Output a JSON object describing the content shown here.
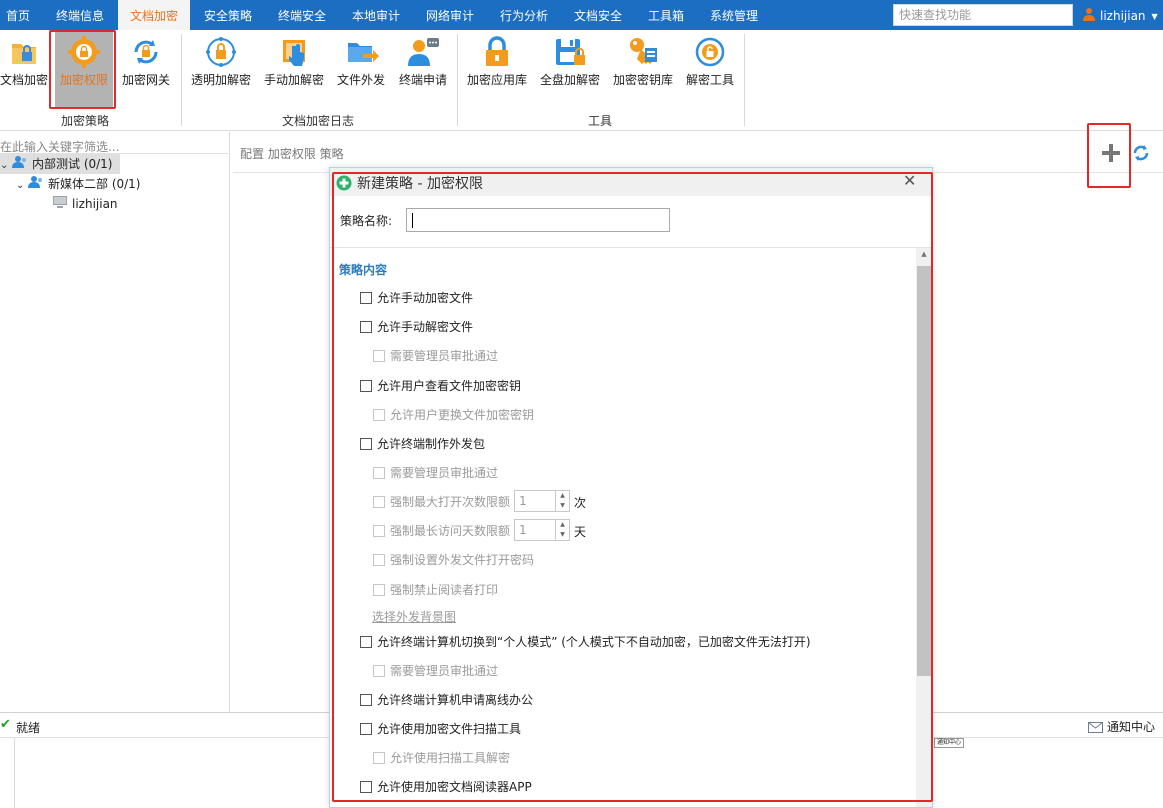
{
  "menu": {
    "items": [
      "首页",
      "终端信息",
      "文档加密",
      "安全策略",
      "终端安全",
      "本地审计",
      "网络审计",
      "行为分析",
      "文档安全",
      "工具箱",
      "系统管理"
    ],
    "active_index": 2,
    "search_placeholder": "快速查找功能",
    "username": "lizhijian"
  },
  "ribbon": {
    "groups": [
      {
        "label": "加密策略",
        "buttons": [
          "文档加密",
          "加密权限",
          "加密网关"
        ]
      },
      {
        "label": "文档加密日志",
        "buttons": [
          "透明加解密",
          "手动加解密",
          "文件外发",
          "终端申请"
        ]
      },
      {
        "label": "工具",
        "buttons": [
          "加密应用库",
          "全盘加解密",
          "加密密钥库",
          "解密工具"
        ]
      }
    ],
    "selected_button": "加密权限"
  },
  "left_panel": {
    "filter_placeholder": "在此输入关键字筛选...",
    "tree": [
      {
        "label": "内部测试 (0/1)",
        "level": 0,
        "expanded": true,
        "icon": "users-icon",
        "selected": true
      },
      {
        "label": "新媒体二部 (0/1)",
        "level": 1,
        "expanded": true,
        "icon": "users-icon"
      },
      {
        "label": "lizhijian",
        "level": 2,
        "icon": "computer-icon"
      }
    ]
  },
  "breadcrumb": "配置 加密权限 策略",
  "status": {
    "text": "就绪",
    "notify": "通知中心",
    "mini_tab": "通知中心"
  },
  "dialog": {
    "title": "新建策略 - 加密权限",
    "name_label": "策略名称:",
    "name_value": "",
    "section_title": "策略内容",
    "options": [
      {
        "label": "允许手动加密文件",
        "enabled": true,
        "checked": false
      },
      {
        "label": "允许手动解密文件",
        "enabled": true,
        "checked": false
      },
      {
        "label": "需要管理员审批通过",
        "enabled": false,
        "checked": false
      },
      {
        "label": "允许用户查看文件加密密钥",
        "enabled": true,
        "checked": false
      },
      {
        "label": "允许用户更换文件加密密钥",
        "enabled": false,
        "checked": false
      },
      {
        "label": "允许终端制作外发包",
        "enabled": true,
        "checked": false
      },
      {
        "label": "需要管理员审批通过",
        "enabled": false,
        "checked": false
      },
      {
        "label": "强制最大打开次数限额",
        "enabled": false,
        "checked": false,
        "value": "1",
        "unit": "次"
      },
      {
        "label": "强制最长访问天数限额",
        "enabled": false,
        "checked": false,
        "value": "1",
        "unit": "天"
      },
      {
        "label": "强制设置外发文件打开密码",
        "enabled": false,
        "checked": false
      },
      {
        "label": "强制禁止阅读者打印",
        "enabled": false,
        "checked": false
      },
      {
        "label": "允许终端计算机切换到“个人模式” (个人模式下不自动加密，已加密文件无法打开)",
        "enabled": true,
        "checked": false
      },
      {
        "label": "需要管理员审批通过",
        "enabled": false,
        "checked": false
      },
      {
        "label": "允许终端计算机申请离线办公",
        "enabled": true,
        "checked": false
      },
      {
        "label": "允许使用加密文件扫描工具",
        "enabled": true,
        "checked": false
      },
      {
        "label": "允许使用扫描工具解密",
        "enabled": false,
        "checked": false
      },
      {
        "label": "允许使用加密文档阅读器APP",
        "enabled": true,
        "checked": false
      }
    ],
    "link_label": "选择外发背景图"
  },
  "colors": {
    "menubar": "#1b6ec2",
    "accent": "#e8731a",
    "highlight": "#e02a2a",
    "section": "#2d7cc1"
  }
}
